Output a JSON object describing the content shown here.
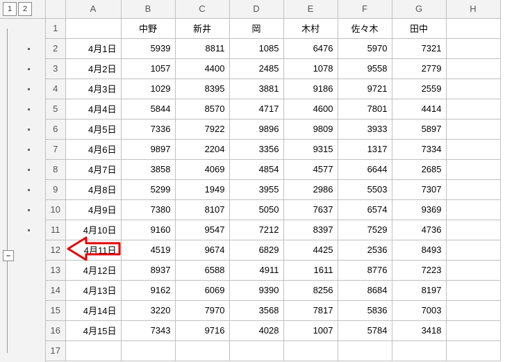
{
  "outline": {
    "level_buttons": [
      "1",
      "2"
    ],
    "collapse_glyph": "−"
  },
  "column_headers": [
    "A",
    "B",
    "C",
    "D",
    "E",
    "F",
    "G",
    "H"
  ],
  "row_headers": [
    "1",
    "2",
    "3",
    "4",
    "5",
    "6",
    "7",
    "8",
    "9",
    "10",
    "11",
    "12",
    "13",
    "14",
    "15",
    "16",
    "17"
  ],
  "chart_data": {
    "type": "table",
    "header_row": [
      "",
      "中野",
      "新井",
      "岡",
      "木村",
      "佐々木",
      "田中"
    ],
    "rows": [
      [
        "4月1日",
        5939,
        8811,
        1085,
        6476,
        5970,
        7321
      ],
      [
        "4月2日",
        1057,
        4400,
        2485,
        1078,
        9558,
        2779
      ],
      [
        "4月3日",
        1029,
        8395,
        3881,
        9186,
        9721,
        2559
      ],
      [
        "4月4日",
        5844,
        8570,
        4717,
        4600,
        7801,
        4414
      ],
      [
        "4月5日",
        7336,
        7922,
        9896,
        9809,
        3933,
        5897
      ],
      [
        "4月6日",
        9897,
        2204,
        3356,
        9315,
        1317,
        7334
      ],
      [
        "4月7日",
        3858,
        4069,
        4854,
        4577,
        6644,
        2685
      ],
      [
        "4月8日",
        5299,
        1949,
        3955,
        2986,
        5503,
        7307
      ],
      [
        "4月9日",
        7380,
        8107,
        5050,
        7637,
        6574,
        9369
      ],
      [
        "4月10日",
        9160,
        9547,
        7212,
        8397,
        7529,
        4736
      ],
      [
        "4月11日",
        4519,
        9674,
        6829,
        4425,
        2536,
        8493
      ],
      [
        "4月12日",
        8937,
        6588,
        4911,
        1611,
        8776,
        7223
      ],
      [
        "4月13日",
        9162,
        6069,
        9390,
        8256,
        8684,
        8197
      ],
      [
        "4月14日",
        3220,
        7970,
        3568,
        7817,
        5836,
        7003
      ],
      [
        "4月15日",
        7343,
        9716,
        4028,
        1007,
        5784,
        3418
      ]
    ]
  }
}
